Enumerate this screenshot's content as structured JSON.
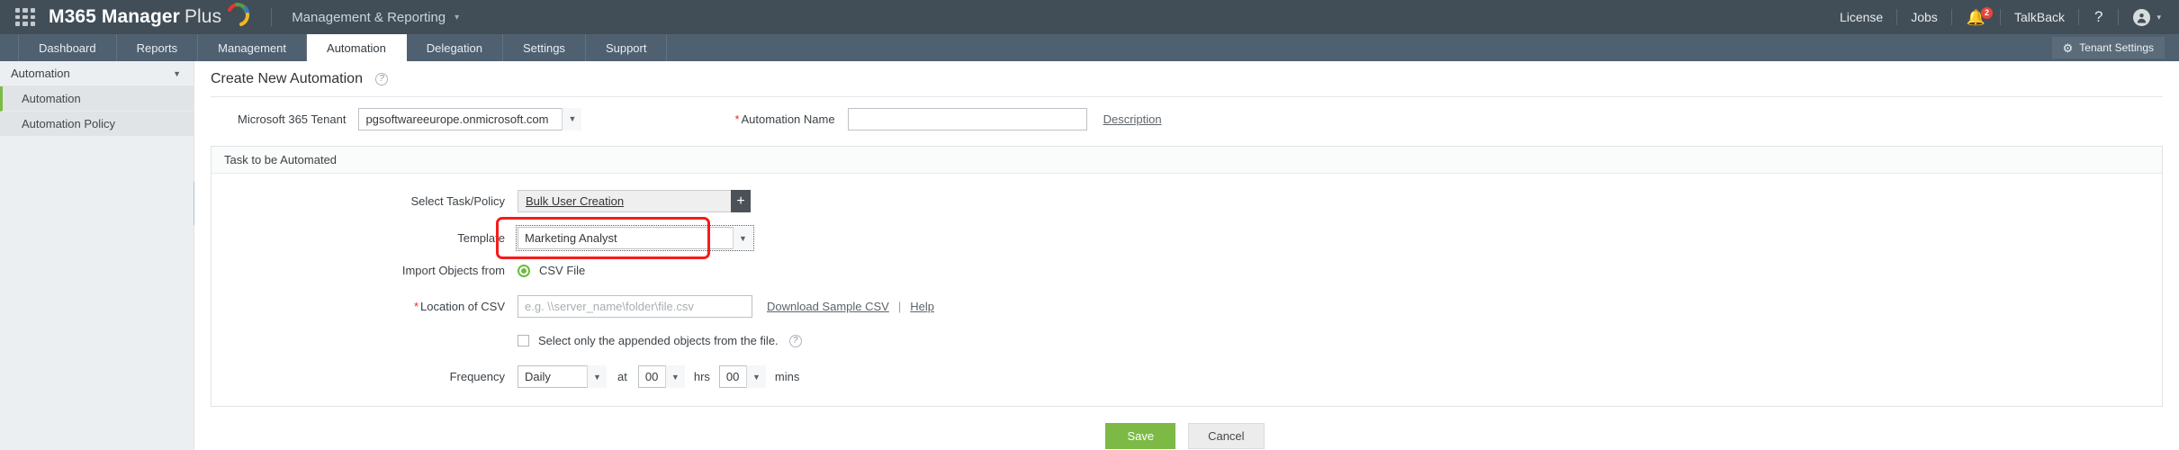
{
  "topbar": {
    "apps_icon": "apps-grid-icon",
    "brand_main": "M365 Manager",
    "brand_thin": "Plus",
    "module_label": "Management & Reporting",
    "module_caret": "▾",
    "right_items": [
      {
        "label": "License",
        "name": "license-link"
      },
      {
        "label": "Jobs",
        "name": "jobs-link"
      }
    ],
    "bell_icon": "🔔",
    "bell_badge": "2",
    "talkback_label": "TalkBack",
    "help_label": "?",
    "avatar_icon": "●",
    "avatar_caret": "▾"
  },
  "nav": {
    "tabs": [
      {
        "label": "Dashboard",
        "active": false
      },
      {
        "label": "Reports",
        "active": false
      },
      {
        "label": "Management",
        "active": false
      },
      {
        "label": "Automation",
        "active": true
      },
      {
        "label": "Delegation",
        "active": false
      },
      {
        "label": "Settings",
        "active": false
      },
      {
        "label": "Support",
        "active": false
      }
    ],
    "tenant_settings_label": "Tenant Settings",
    "gear_icon": "⚙"
  },
  "sidebar": {
    "header_label": "Automation",
    "header_caret": "▼",
    "items": [
      {
        "label": "Automation",
        "active": true
      },
      {
        "label": "Automation Policy",
        "active": false
      }
    ],
    "collapse_arrow": "◀"
  },
  "page": {
    "title": "Create New Automation",
    "help_icon": "?"
  },
  "tenant_row": {
    "tenant_label": "Microsoft 365 Tenant",
    "tenant_value": "pgsoftwareeurope.onmicrosoft.com",
    "automation_name_required": "*",
    "automation_name_label": "Automation Name",
    "automation_name_value": "",
    "automation_name_placeholder": "",
    "description_link": "Description"
  },
  "task_panel": {
    "header": "Task to be Automated",
    "select_task_label": "Select Task/Policy",
    "select_task_value": "Bulk User Creation",
    "add_button": "+",
    "template_label": "Template",
    "template_value": "Marketing Analyst",
    "import_label": "Import Objects from",
    "import_option": "CSV File",
    "location_required": "*",
    "location_label": "Location of CSV",
    "location_value": "",
    "location_placeholder": "e.g. \\\\server_name\\folder\\file.csv",
    "download_sample_link": "Download Sample CSV",
    "link_separator": "|",
    "help_link": "Help",
    "appended_checkbox_label": "Select only the appended objects from the file.",
    "appended_help_icon": "?",
    "frequency_label": "Frequency",
    "frequency_value": "Daily",
    "at_label": "at",
    "hours_value": "00",
    "hours_label": "hrs",
    "minutes_value": "00",
    "minutes_label": "mins"
  },
  "footer": {
    "save_label": "Save",
    "cancel_label": "Cancel"
  },
  "colors": {
    "topbar_bg": "#414e58",
    "navbar_bg": "#4f6070",
    "accent_green": "#7cba45",
    "highlight_red": "#f71b1b",
    "badge_red": "#e8453c"
  }
}
